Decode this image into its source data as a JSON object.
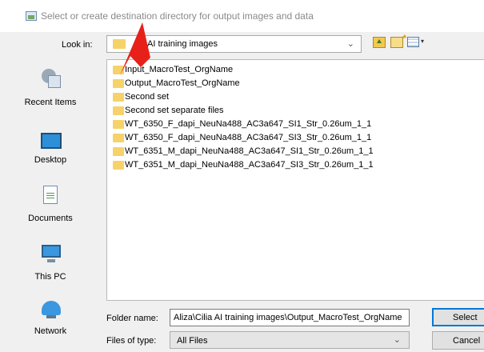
{
  "dialog": {
    "title": "Select or create destination directory for output images and data"
  },
  "look_in": {
    "label": "Look in:",
    "value": "AI training images"
  },
  "sidebar": {
    "items": [
      {
        "label": "Recent Items",
        "icon": "recent-items-icon"
      },
      {
        "label": "Desktop",
        "icon": "desktop-icon"
      },
      {
        "label": "Documents",
        "icon": "documents-icon"
      },
      {
        "label": "This PC",
        "icon": "this-pc-icon"
      },
      {
        "label": "Network",
        "icon": "network-icon"
      }
    ]
  },
  "files": [
    "Input_MacroTest_OrgName",
    "Output_MacroTest_OrgName",
    "Second set",
    "Second set separate files",
    "WT_6350_F_dapi_NeuNa488_AC3a647_SI1_Str_0.26um_1_1",
    "WT_6350_F_dapi_NeuNa488_AC3a647_SI3_Str_0.26um_1_1",
    "WT_6351_M_dapi_NeuNa488_AC3a647_SI1_Str_0.26um_1_1",
    "WT_6351_M_dapi_NeuNa488_AC3a647_SI3_Str_0.26um_1_1"
  ],
  "folder_name": {
    "label": "Folder name:",
    "value": "Aliza\\Cilia AI training images\\Output_MacroTest_OrgName"
  },
  "files_of_type": {
    "label": "Files of type:",
    "value": "All Files"
  },
  "buttons": {
    "select": "Select",
    "cancel": "Cancel"
  },
  "colors": {
    "annotation_arrow": "#e8201a",
    "folder": "#f6d26a",
    "focus_border": "#0078d7"
  }
}
